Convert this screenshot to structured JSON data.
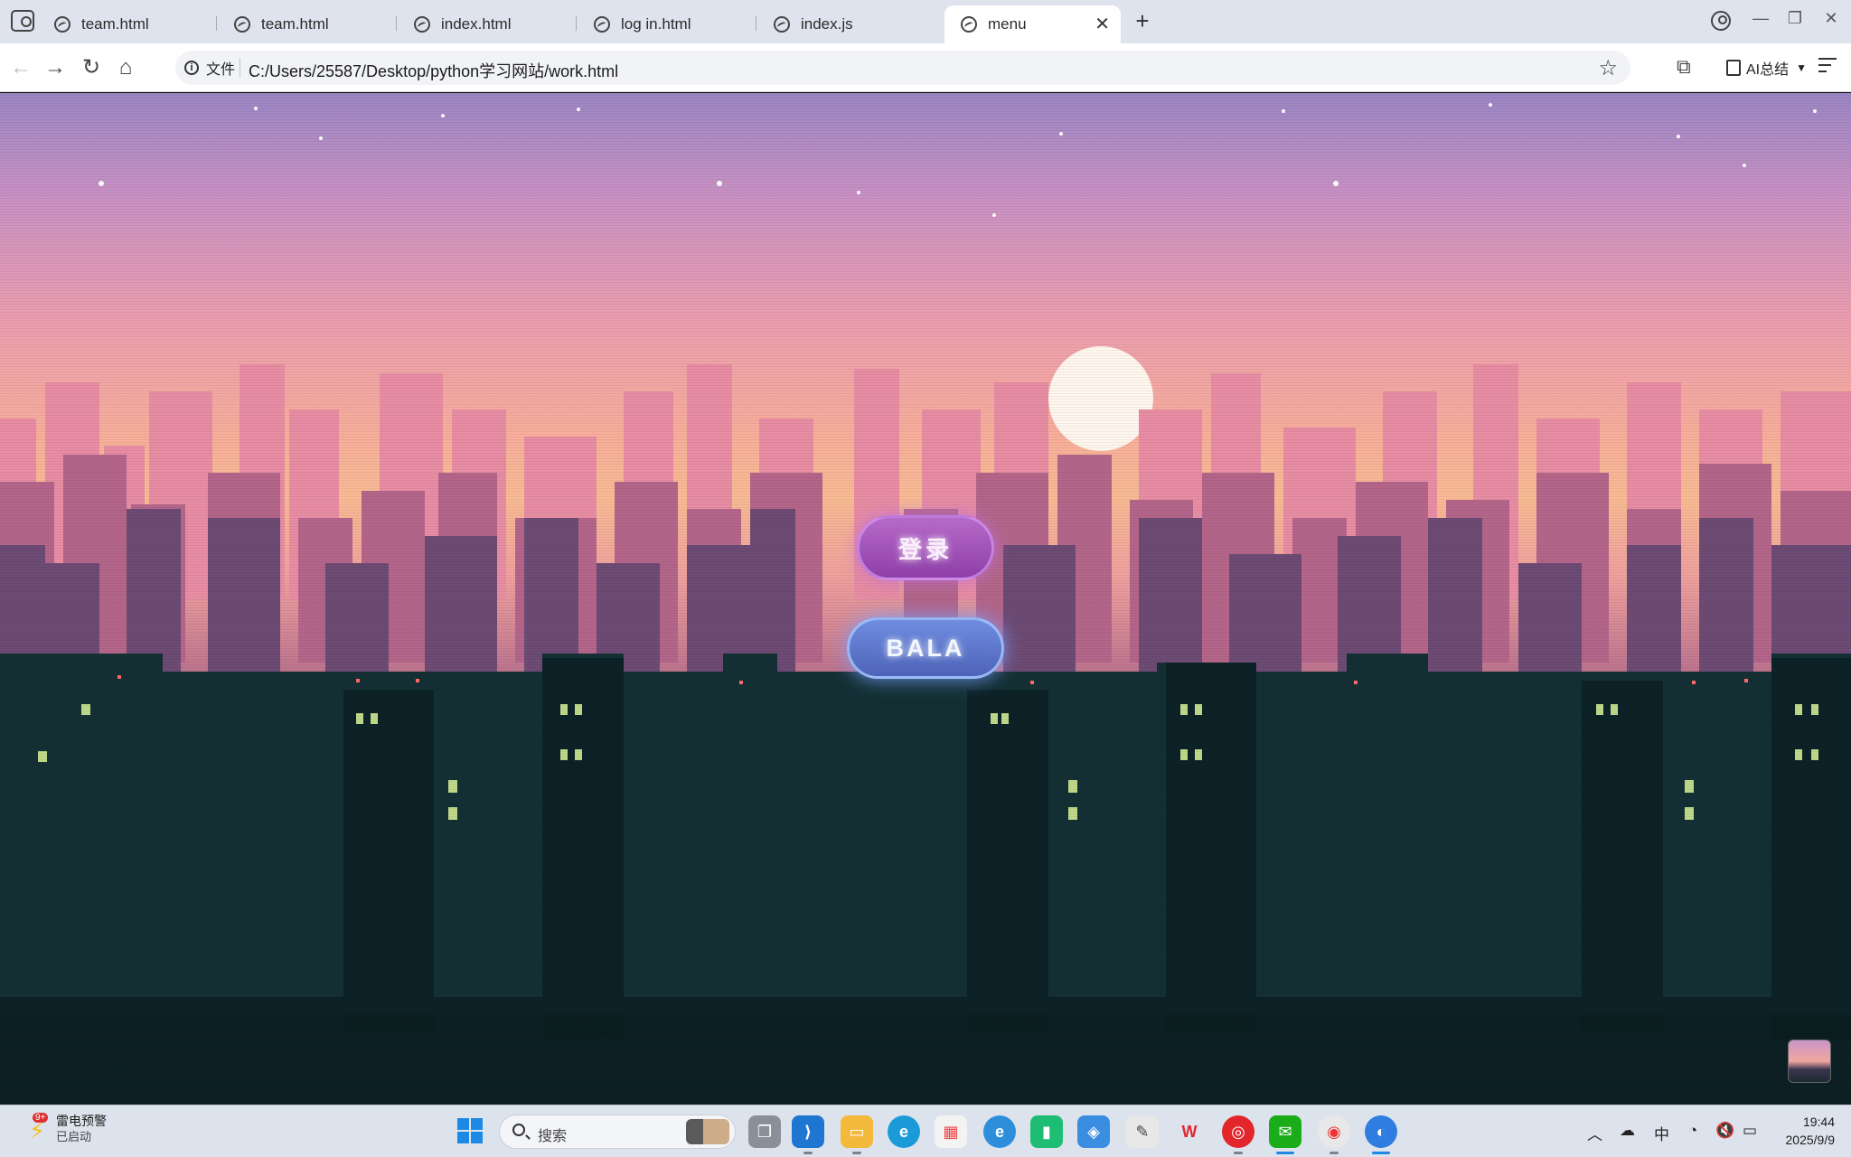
{
  "browser": {
    "tabs": [
      {
        "label": "team.html",
        "active": false
      },
      {
        "label": "team.html",
        "active": false
      },
      {
        "label": "index.html",
        "active": false
      },
      {
        "label": "log in.html",
        "active": false
      },
      {
        "label": "index.js",
        "active": false
      },
      {
        "label": "menu",
        "active": true
      }
    ],
    "new_tab_label": "+",
    "close_label": "✕",
    "address": {
      "scheme_label": "文件",
      "url": "C:/Users/25587/Desktop/python学习网站/work.html"
    },
    "ai_summary_label": "AI总结"
  },
  "page": {
    "login_button": "登录",
    "bala_button": "BALA"
  },
  "taskbar": {
    "weather": {
      "badge": "9+",
      "title": "雷电预警",
      "status": "已启动"
    },
    "search_placeholder": "搜索",
    "tray_ime": "中",
    "clock": {
      "time": "19:44",
      "date": "2025/9/9"
    }
  },
  "colors": {
    "sky_top": "#9b86c4",
    "sky_mid": "#f7ad9c",
    "city_far": "#e68aa0",
    "city_mid": "#a8607f",
    "city_near": "#0f2a2e",
    "login_button": "#a353bb",
    "bala_button": "#5c76cf"
  }
}
